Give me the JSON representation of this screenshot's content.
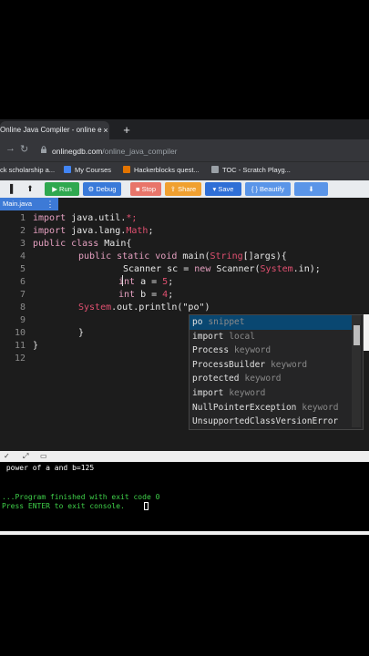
{
  "browser": {
    "tab_title": "Online Java Compiler - online e",
    "tab_close": "×",
    "new_tab": "+",
    "url_host": "onlinegdb.com",
    "url_path": "/online_java_compiler",
    "bookmarks": [
      {
        "label": "ck scholarship a...",
        "icon_color": "#f4b400"
      },
      {
        "label": "My Courses",
        "icon_color": "#4285f4"
      },
      {
        "label": "Hackerblocks quest...",
        "icon_color": "#e37400"
      },
      {
        "label": "TOC - Scratch Playg...",
        "icon_color": "#9aa0a6"
      }
    ]
  },
  "toolbar": {
    "run": "Run",
    "debug": "Debug",
    "stop": "Stop",
    "share": "Share",
    "save": "Save",
    "beautify": "{ } Beautify",
    "colors": {
      "run": "#2fa84f",
      "debug": "#3a7ad9",
      "stop": "#e8756a",
      "share": "#f0a030",
      "save": "#2f6fd6",
      "beautify": "#5a95e8",
      "download": "#5a95e8"
    }
  },
  "file_tab": {
    "label": "Main.java",
    "menu": "⋮"
  },
  "editor": {
    "line_numbers": [
      "1",
      "2",
      "3",
      "4",
      "5",
      "6",
      "7",
      "8",
      "9",
      "10",
      "11",
      "12"
    ],
    "lines": {
      "l1_kw": "import",
      "l1_rest": " java.util.",
      "l1_end": "*;",
      "l2_kw": "import",
      "l2_rest": " java.lang.",
      "l2_cls": "Math",
      "l2_end": ";",
      "l3_kw": "public class",
      "l3_rest": " Main{",
      "l4_kw": "public static void",
      "l4_rest": " main(",
      "l4_cls": "String",
      "l4_end": "[]args){",
      "l5_a": "Scanner sc = ",
      "l5_kw": "new",
      "l5_b": " Scanner(",
      "l5_cls": "System",
      "l5_end": ".in);",
      "l6_kw": "int",
      "l6_a": " a = ",
      "l6_num": "5",
      "l6_end": ";",
      "l7_kw": "int",
      "l7_a": " b = ",
      "l7_num": "4",
      "l7_end": ";",
      "l8_cls": "System",
      "l8_a": ".out.println(",
      "l8_str": "\"po\"",
      "l8_end": ")",
      "l10": "}",
      "l11": "}"
    }
  },
  "autocomplete": [
    {
      "label": "po",
      "tag": "snippet"
    },
    {
      "label": "import",
      "tag": "local"
    },
    {
      "label": "Process",
      "tag": "keyword"
    },
    {
      "label": "ProcessBuilder",
      "tag": "keyword"
    },
    {
      "label": "protected",
      "tag": "keyword"
    },
    {
      "label": "import",
      "tag": "keyword"
    },
    {
      "label": "NullPointerException",
      "tag": "keyword"
    },
    {
      "label": "UnsupportedClassVersionError",
      "tag": ""
    }
  ],
  "console": {
    "output": " power of a and b=125",
    "exit": "...Program finished with exit code 0",
    "enter": "Press ENTER to exit console."
  }
}
